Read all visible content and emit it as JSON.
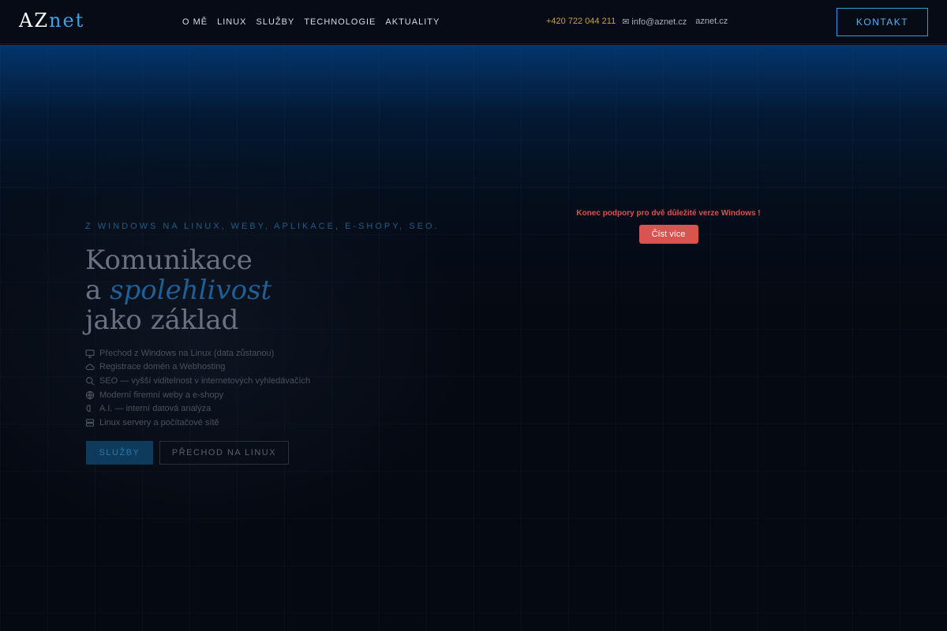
{
  "header": {
    "logo": {
      "part1": "AZ",
      "part2": "net"
    },
    "nav": [
      {
        "label": "O MĚ"
      },
      {
        "label": "LINUX"
      },
      {
        "label": "SLUŽBY"
      },
      {
        "label": "TECHNOLOGIE"
      },
      {
        "label": "AKTUALITY"
      }
    ],
    "contacts": {
      "phone": "+420 722 044 211",
      "email": "info@aznet.cz",
      "web": "aznet.cz"
    },
    "contact_button": "KONTAKT"
  },
  "hero": {
    "eyebrow": "Z WINDOWS NA LINUX, WEBY, APLIKACE, E-SHOPY, SEO.",
    "headline": {
      "line1": "Komunikace",
      "line2_prefix": "a ",
      "line2_emphasis": "spolehlivost",
      "line3": "jako základ"
    },
    "features": [
      {
        "icon": "monitor-icon",
        "text": "Přechod z Windows na Linux (data zůstanou)"
      },
      {
        "icon": "cloud-icon",
        "text": "Registrace domén a Webhosting"
      },
      {
        "icon": "search-icon",
        "text": "SEO — vyšší viditelnost v internetových vyhledávačích"
      },
      {
        "icon": "globe-icon",
        "text": "Moderní firemní weby a e-shopy"
      },
      {
        "icon": "brain-icon",
        "text": "A.I. — interní datová analýza"
      },
      {
        "icon": "server-icon",
        "text": "Linux servery a počítačové sítě"
      }
    ],
    "buttons": {
      "primary": "SLUŽBY",
      "secondary": "PŘECHOD NA LINUX"
    }
  },
  "alert": {
    "message": "Konec podpory pro dvě důležité verze Windows !",
    "button": "Číst více"
  },
  "colors": {
    "accent": "#3aa3e6",
    "alert": "#d9534f",
    "phone": "#c8a33a"
  }
}
